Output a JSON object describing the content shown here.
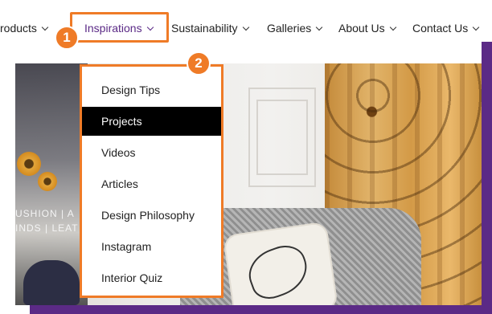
{
  "nav": {
    "items": [
      {
        "label": "Products",
        "has_dropdown": true,
        "active": false
      },
      {
        "label": "Inspirations",
        "has_dropdown": true,
        "active": true
      },
      {
        "label": "Sustainability",
        "has_dropdown": true,
        "active": false
      },
      {
        "label": "Galleries",
        "has_dropdown": true,
        "active": false
      },
      {
        "label": "About Us",
        "has_dropdown": true,
        "active": false
      },
      {
        "label": "Contact Us",
        "has_dropdown": true,
        "active": false
      }
    ],
    "visible_text": [
      "roducts",
      "Inspirations",
      "Sustainability",
      "Galleries",
      "About Us",
      "Contact Us"
    ]
  },
  "badges": {
    "one": "1",
    "two": "2"
  },
  "dropdown": {
    "items": [
      {
        "label": "Design Tips",
        "selected": false
      },
      {
        "label": "Projects",
        "selected": true
      },
      {
        "label": "Videos",
        "selected": false
      },
      {
        "label": "Articles",
        "selected": false
      },
      {
        "label": "Design Philosophy",
        "selected": false
      },
      {
        "label": "Instagram",
        "selected": false
      },
      {
        "label": "Interior Quiz",
        "selected": false
      }
    ]
  },
  "hero": {
    "text_line1": "USHION | A",
    "text_line2": "INDS | LEAT"
  },
  "colors": {
    "accent_orange": "#ef7b27",
    "frame_purple": "#5b2a86",
    "active_nav": "#5b2a86",
    "selected_item_bg": "#000000"
  }
}
